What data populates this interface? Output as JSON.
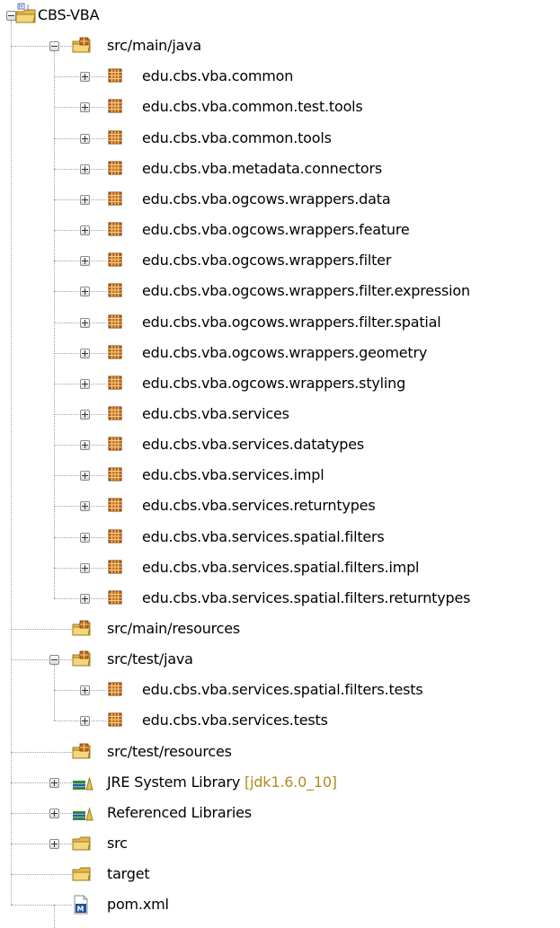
{
  "rows": [
    {
      "depth": 0,
      "icon": "project-icon",
      "label": "CBS-VBA",
      "expander": "minus"
    },
    {
      "depth": 1,
      "icon": "source-folder-icon",
      "label": "src/main/java",
      "expander": "minus"
    },
    {
      "depth": 2,
      "icon": "package-icon",
      "label": "edu.cbs.vba.common",
      "expander": "plus"
    },
    {
      "depth": 2,
      "icon": "package-icon",
      "label": "edu.cbs.vba.common.test.tools",
      "expander": "plus"
    },
    {
      "depth": 2,
      "icon": "package-icon",
      "label": "edu.cbs.vba.common.tools",
      "expander": "plus"
    },
    {
      "depth": 2,
      "icon": "package-icon",
      "label": "edu.cbs.vba.metadata.connectors",
      "expander": "plus"
    },
    {
      "depth": 2,
      "icon": "package-icon",
      "label": "edu.cbs.vba.ogcows.wrappers.data",
      "expander": "plus"
    },
    {
      "depth": 2,
      "icon": "package-icon",
      "label": "edu.cbs.vba.ogcows.wrappers.feature",
      "expander": "plus"
    },
    {
      "depth": 2,
      "icon": "package-icon",
      "label": "edu.cbs.vba.ogcows.wrappers.filter",
      "expander": "plus"
    },
    {
      "depth": 2,
      "icon": "package-icon",
      "label": "edu.cbs.vba.ogcows.wrappers.filter.expression",
      "expander": "plus"
    },
    {
      "depth": 2,
      "icon": "package-icon",
      "label": "edu.cbs.vba.ogcows.wrappers.filter.spatial",
      "expander": "plus"
    },
    {
      "depth": 2,
      "icon": "package-icon",
      "label": "edu.cbs.vba.ogcows.wrappers.geometry",
      "expander": "plus"
    },
    {
      "depth": 2,
      "icon": "package-icon",
      "label": "edu.cbs.vba.ogcows.wrappers.styling",
      "expander": "plus"
    },
    {
      "depth": 2,
      "icon": "package-icon",
      "label": "edu.cbs.vba.services",
      "expander": "plus"
    },
    {
      "depth": 2,
      "icon": "package-icon",
      "label": "edu.cbs.vba.services.datatypes",
      "expander": "plus"
    },
    {
      "depth": 2,
      "icon": "package-icon",
      "label": "edu.cbs.vba.services.impl",
      "expander": "plus"
    },
    {
      "depth": 2,
      "icon": "package-icon",
      "label": "edu.cbs.vba.services.returntypes",
      "expander": "plus"
    },
    {
      "depth": 2,
      "icon": "package-icon",
      "label": "edu.cbs.vba.services.spatial.filters",
      "expander": "plus"
    },
    {
      "depth": 2,
      "icon": "package-icon",
      "label": "edu.cbs.vba.services.spatial.filters.impl",
      "expander": "plus"
    },
    {
      "depth": 2,
      "icon": "package-icon",
      "label": "edu.cbs.vba.services.spatial.filters.returntypes",
      "expander": "plus"
    },
    {
      "depth": 1,
      "icon": "source-folder-icon",
      "label": "src/main/resources",
      "expander": "none"
    },
    {
      "depth": 1,
      "icon": "source-folder-icon",
      "label": "src/test/java",
      "expander": "minus"
    },
    {
      "depth": 2,
      "icon": "package-icon",
      "label": "edu.cbs.vba.services.spatial.filters.tests",
      "expander": "plus"
    },
    {
      "depth": 2,
      "icon": "package-icon",
      "label": "edu.cbs.vba.services.tests",
      "expander": "plus"
    },
    {
      "depth": 1,
      "icon": "source-folder-icon",
      "label": "src/test/resources",
      "expander": "none"
    },
    {
      "depth": 1,
      "icon": "library-icon",
      "label": "JRE System Library",
      "decoration": "[jdk1.6.0_10]",
      "expander": "plus"
    },
    {
      "depth": 1,
      "icon": "library-icon",
      "label": "Referenced Libraries",
      "expander": "plus"
    },
    {
      "depth": 1,
      "icon": "folder-icon",
      "label": "src",
      "expander": "plus"
    },
    {
      "depth": 1,
      "icon": "folder-icon",
      "label": "target",
      "expander": "none"
    },
    {
      "depth": 1,
      "icon": "maven-file-icon",
      "label": "pom.xml",
      "expander": "none"
    }
  ],
  "colors": {
    "decoration": "#b28a1e",
    "package": "#c46a1a",
    "folder": "#e8b84a",
    "library_green": "#2e8b3a",
    "library_blue": "#2a58a8",
    "maven_blue": "#1c4fa3"
  }
}
